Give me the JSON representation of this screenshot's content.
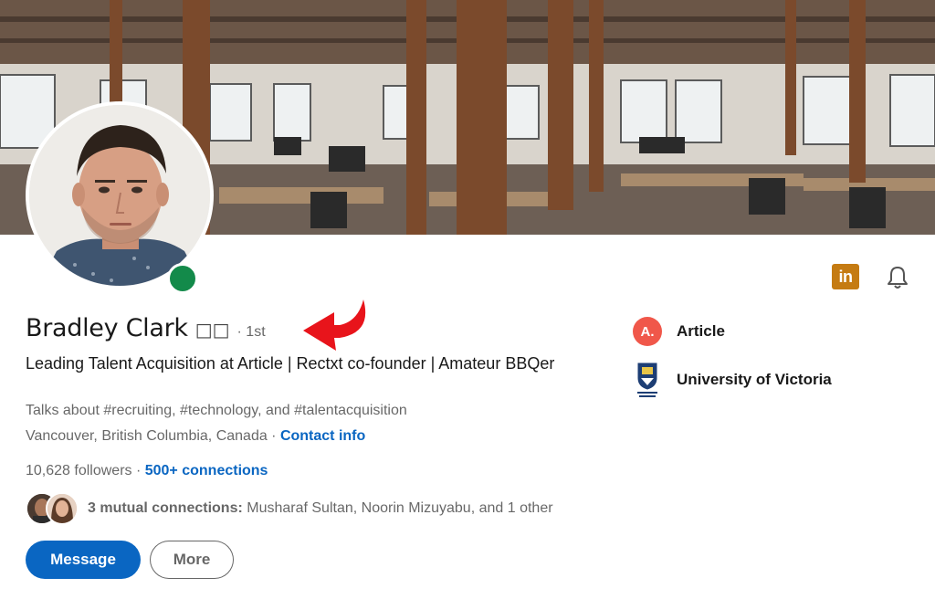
{
  "profile": {
    "name": "Bradley Clark",
    "name_emoji": "□□",
    "degree": "· 1st",
    "headline": "Leading Talent Acquisition at Article | Rectxt co-founder | Amateur BBQer",
    "talks_about": "Talks about #recruiting, #technology, and #talentacquisition",
    "location": "Vancouver, British Columbia, Canada",
    "location_separator": " · ",
    "contact_info": "Contact info",
    "followers": "10,628 followers",
    "connections_separator": " · ",
    "connections": "500+ connections",
    "mutual_label": "3 mutual connections:",
    "mutual_names": " Musharaf Sultan, Noorin Mizuyabu, and 1 other"
  },
  "actions": {
    "message": "Message",
    "more": "More"
  },
  "right_panel": {
    "company_logo_letter": "A.",
    "company": "Article",
    "school": "University of Victoria"
  },
  "icons": {
    "linkedin_badge": "in",
    "bell": "bell-icon"
  },
  "colors": {
    "brand_blue": "#0a66c2",
    "online_green": "#138a4a",
    "linkedin_badge": "#c57b12",
    "company_logo": "#f0574a",
    "annotation_arrow": "#e8141b"
  }
}
